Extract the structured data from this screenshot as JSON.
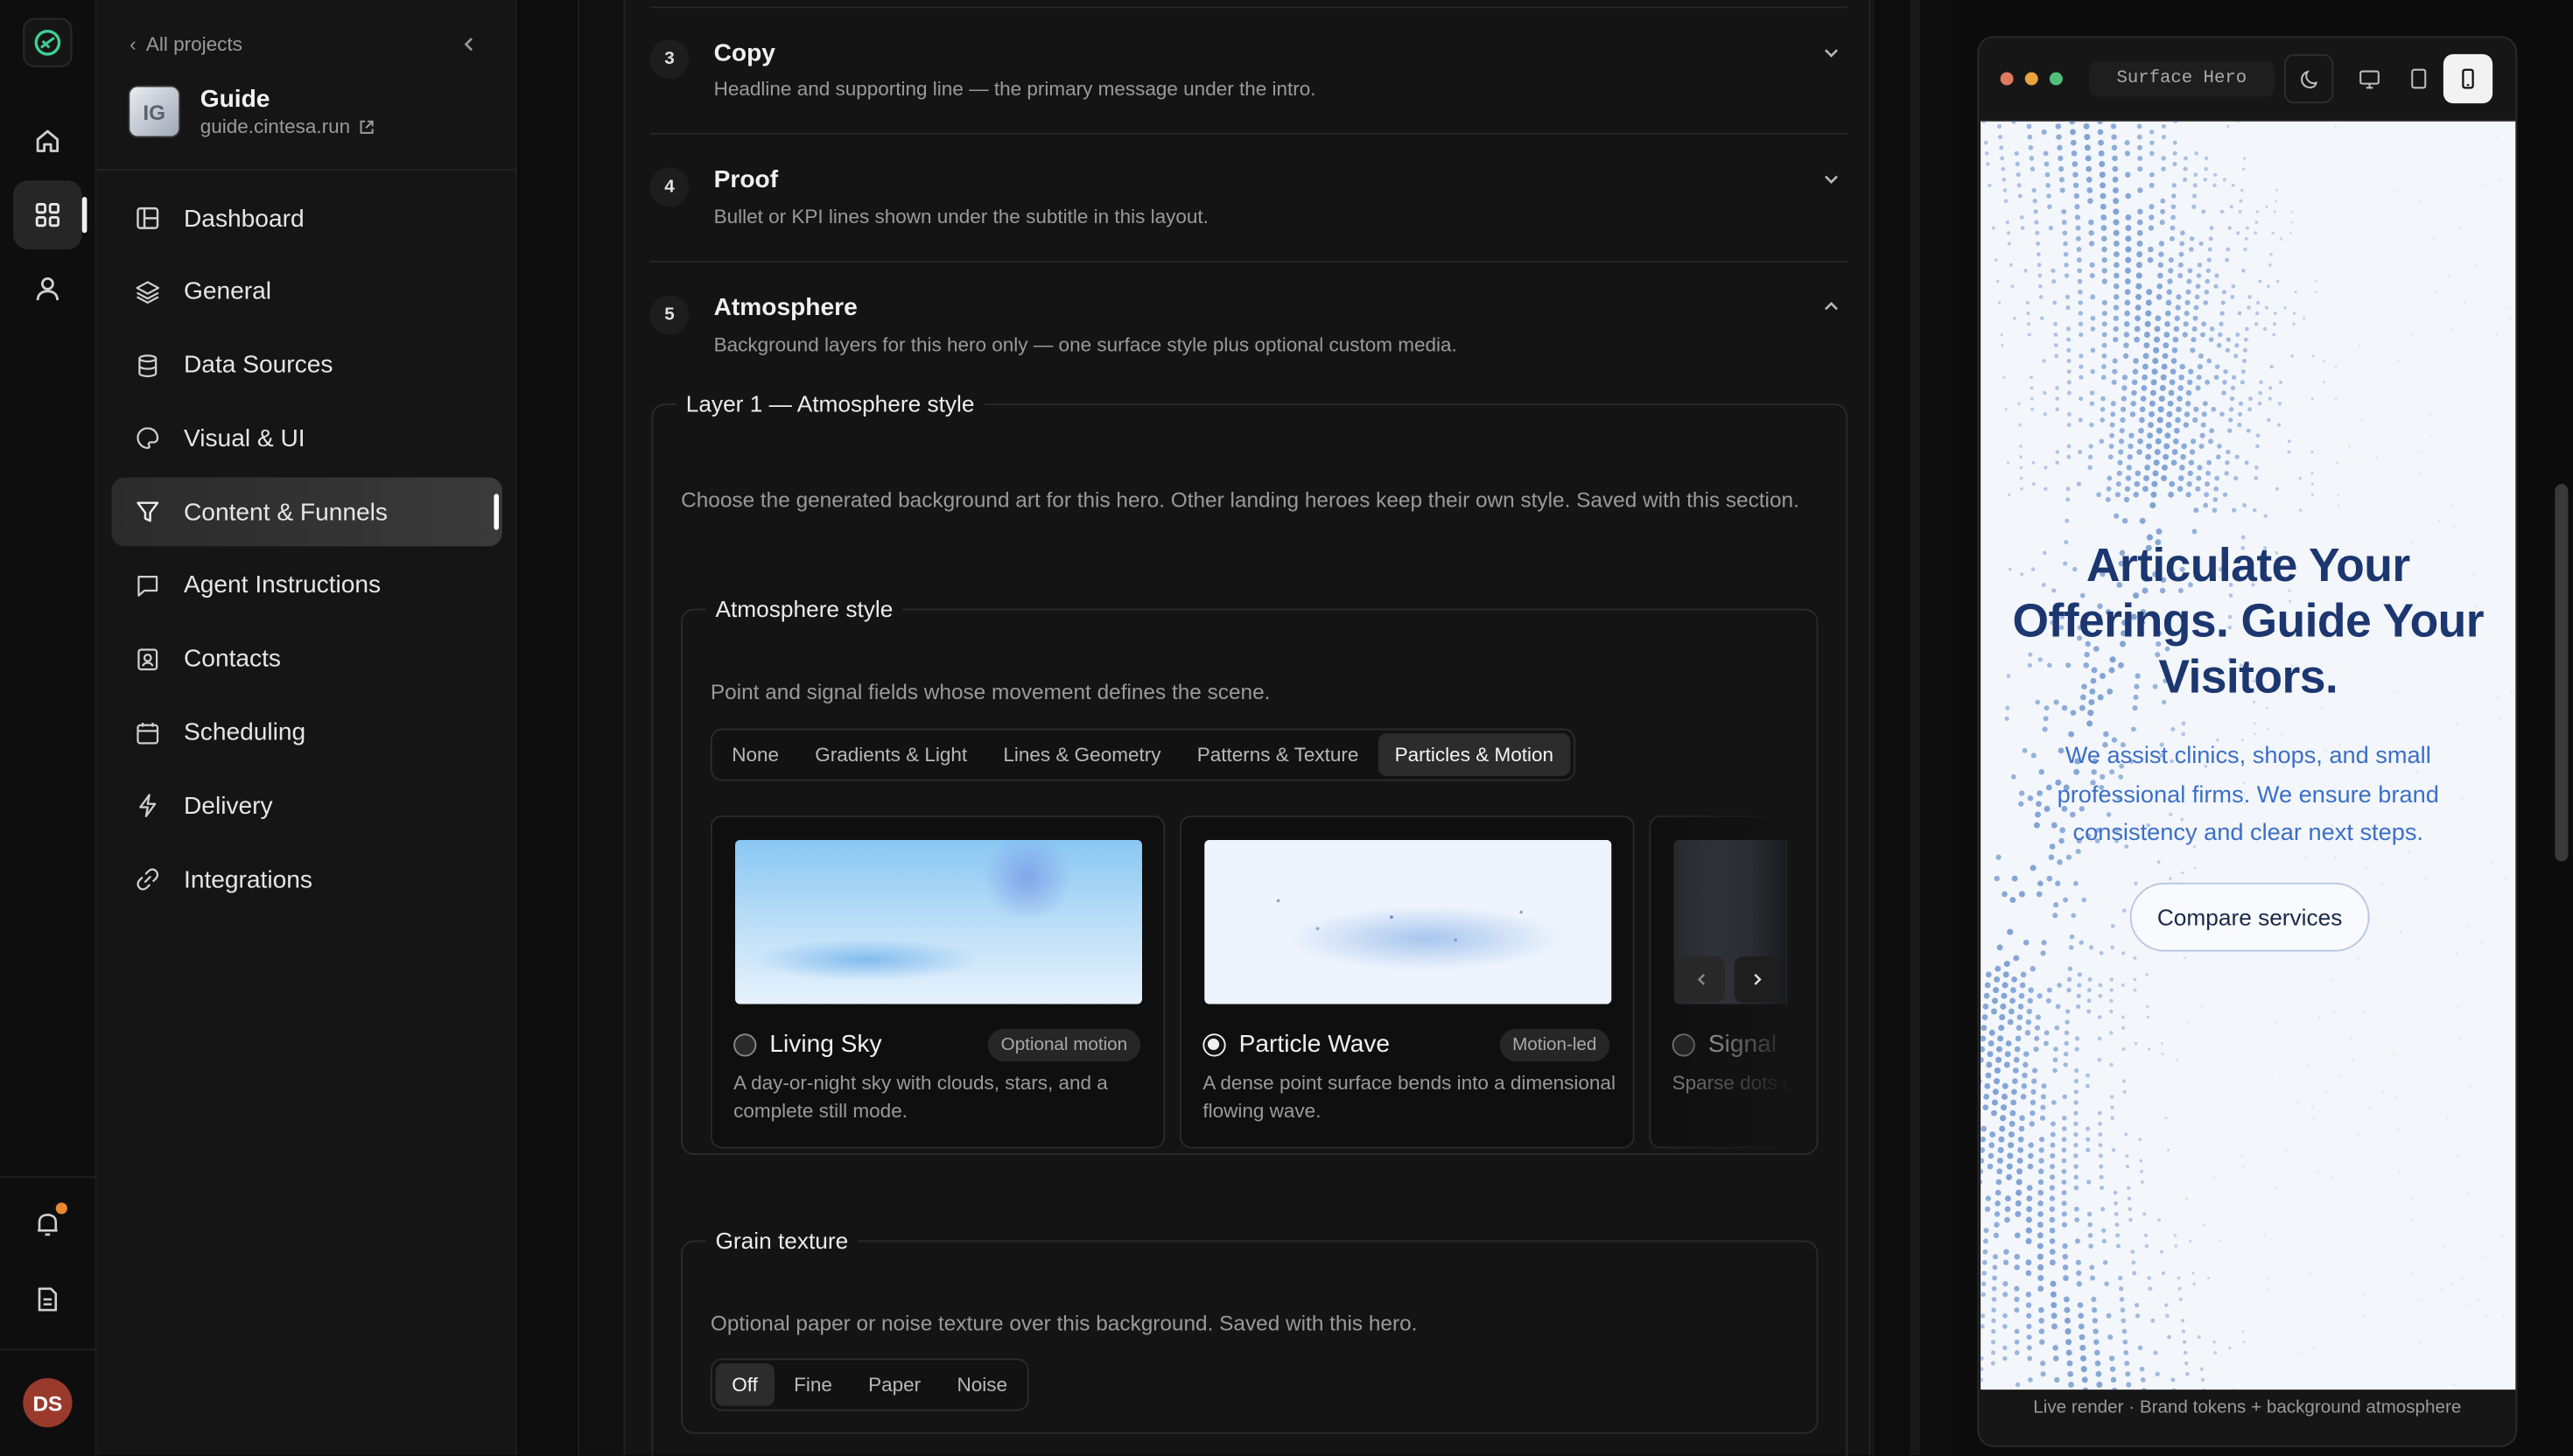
{
  "sidebar": {
    "back_label": "All projects",
    "project": {
      "name": "Guide",
      "url": "guide.cintesa.run",
      "logo_text": "IG"
    },
    "items": [
      {
        "label": "Dashboard",
        "icon": "dashboard-icon"
      },
      {
        "label": "General",
        "icon": "layers-icon"
      },
      {
        "label": "Data Sources",
        "icon": "database-icon"
      },
      {
        "label": "Visual & UI",
        "icon": "palette-icon"
      },
      {
        "label": "Content & Funnels",
        "icon": "filter-icon",
        "active": true
      },
      {
        "label": "Agent Instructions",
        "icon": "chat-icon"
      },
      {
        "label": "Contacts",
        "icon": "contact-icon"
      },
      {
        "label": "Scheduling",
        "icon": "calendar-icon"
      },
      {
        "label": "Delivery",
        "icon": "bolt-icon"
      },
      {
        "label": "Integrations",
        "icon": "link-icon"
      }
    ]
  },
  "user": {
    "initials": "DS"
  },
  "sections": [
    {
      "num": "3",
      "title": "Copy",
      "desc": "Headline and supporting line — the primary message under the intro."
    },
    {
      "num": "4",
      "title": "Proof",
      "desc": "Bullet or KPI lines shown under the subtitle in this layout."
    },
    {
      "num": "5",
      "title": "Atmosphere",
      "desc": "Background layers for this hero only — one surface style plus optional custom media."
    }
  ],
  "layer1": {
    "legend": "Layer 1 — Atmosphere style",
    "note": "Choose the generated background art for this hero. Other landing heroes keep their own style. Saved with this section.",
    "style_group": {
      "legend": "Atmosphere style",
      "note": "Point and signal fields whose movement defines the scene.",
      "tabs": [
        "None",
        "Gradients & Light",
        "Lines & Geometry",
        "Patterns & Texture",
        "Particles & Motion"
      ],
      "selected_tab": "Particles & Motion",
      "cards": [
        {
          "name": "Living Sky",
          "badge": "Optional motion",
          "desc": "A day-or-night sky with clouds, stars, and a complete still mode.",
          "selected": false
        },
        {
          "name": "Particle Wave",
          "badge": "Motion-led",
          "desc": "A dense point surface bends into a dimensional flowing wave.",
          "selected": true
        },
        {
          "name": "Signal",
          "badge": "",
          "desc": "Sparse dots quiet data-",
          "selected": false
        }
      ]
    },
    "grain": {
      "legend": "Grain texture",
      "note": "Optional paper or noise texture over this background. Saved with this hero.",
      "options": [
        "Off",
        "Fine",
        "Paper",
        "Noise"
      ],
      "selected": "Off"
    }
  },
  "preview": {
    "title": "Surface Hero",
    "headline": "Articulate Your Offerings. Guide Your Visitors.",
    "subtitle": "We assist clinics, shops, and small professional firms. We ensure brand consistency and clear next steps.",
    "cta": "Compare services",
    "footer": "Live render · Brand tokens + background atmosphere",
    "device_selected": "mobile"
  },
  "colors": {
    "accent_dot": "#e8892f",
    "hero_heading": "#1c3770",
    "hero_text": "#3b6fc7",
    "brand_green": "#3ecf8e"
  }
}
